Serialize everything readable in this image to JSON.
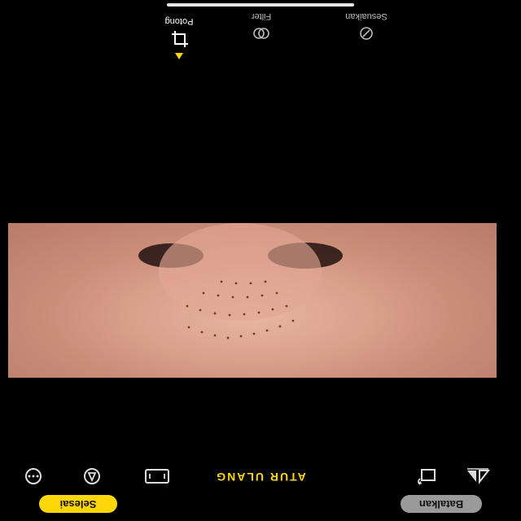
{
  "bottom_bar": {
    "cancel_label": "Batalkan",
    "done_label": "Selesai"
  },
  "toolbar": {
    "reset_label": "ATUR ULANG",
    "icons": [
      "aspect-flip-icon",
      "rotate-icon",
      "aspect-ratio-icon",
      "markup-icon",
      "more-icon"
    ]
  },
  "tabs": [
    {
      "label": "Sesuaikan",
      "icon": "adjust-dial-icon",
      "active": false
    },
    {
      "label": "Filter",
      "icon": "filter-circles-icon",
      "active": false
    },
    {
      "label": "Potong",
      "icon": "crop-icon",
      "active": true
    }
  ],
  "colors": {
    "accent": "#ffd60a",
    "background": "#000000",
    "cancel_pill": "#9a9a9a"
  }
}
